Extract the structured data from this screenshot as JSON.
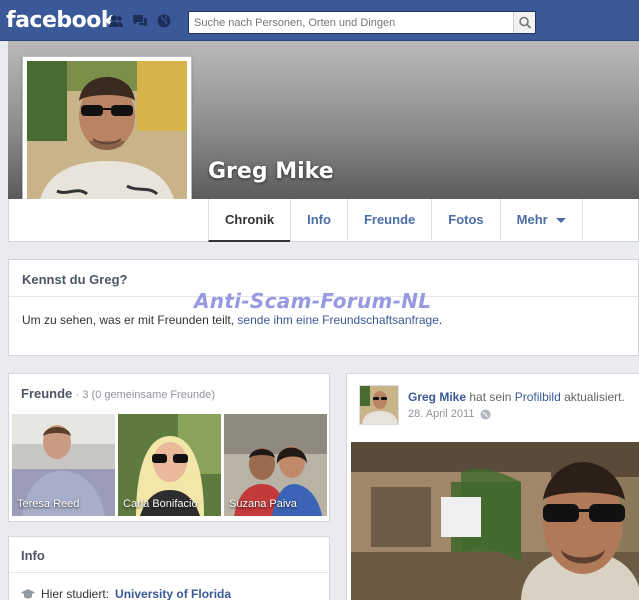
{
  "topbar": {
    "logo": "facebook",
    "search_placeholder": "Suche nach Personen, Orten und Dingen",
    "icons": [
      "friends-icon",
      "messages-icon",
      "notifications-globe-icon",
      "search-icon"
    ]
  },
  "profile": {
    "name": "Greg Mike"
  },
  "tabs": [
    {
      "label": "Chronik",
      "active": true
    },
    {
      "label": "Info"
    },
    {
      "label": "Freunde"
    },
    {
      "label": "Fotos"
    },
    {
      "label": "Mehr"
    }
  ],
  "know": {
    "title": "Kennst du Greg?",
    "text_before": "Um zu sehen, was er mit Freunden teilt, ",
    "link": "sende ihm eine Freundschaftsanfrage",
    "text_after": "."
  },
  "watermark": "Anti-Scam-Forum-NL",
  "friends": {
    "title": "Freunde",
    "count": "· 3 (0 gemeinsame Freunde)",
    "list": [
      {
        "name": "Teresa Reed"
      },
      {
        "name": "Carla Bonifacio"
      },
      {
        "name": "Suzana Paiva"
      }
    ]
  },
  "info": {
    "title": "Info",
    "row_prefix": "Hier studiert:",
    "row_link": "University of Florida"
  },
  "post": {
    "author": "Greg Mike",
    "action": "hat sein",
    "object_link": "Profilbild",
    "action_end": "aktualisiert.",
    "date": "28. April 2011"
  },
  "colors": {
    "brand": "#3b5998",
    "link": "#3b5998",
    "watermark": "#8d8ee0"
  }
}
